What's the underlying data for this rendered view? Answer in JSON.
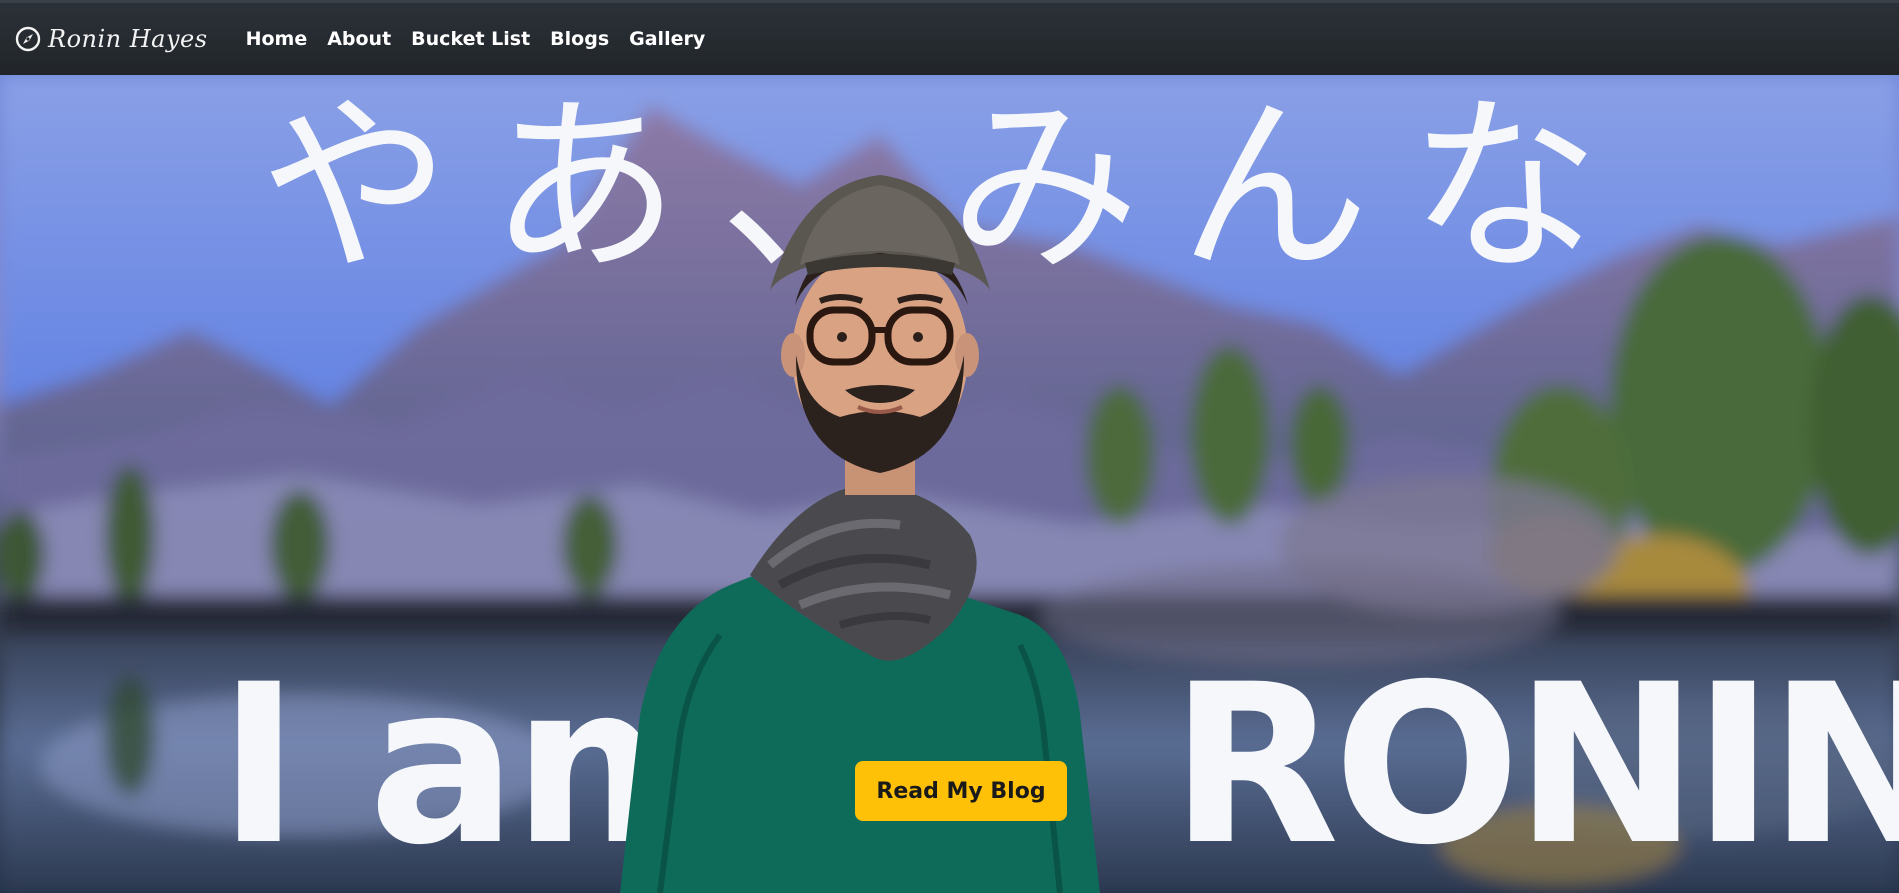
{
  "navbar": {
    "brand_name": "Ronin Hayes",
    "brand_icon": "compass-icon",
    "links": [
      "Home",
      "About",
      "Bucket List",
      "Blogs",
      "Gallery"
    ]
  },
  "hero": {
    "greeting": "やあ、みんな",
    "intro_left": "I am",
    "intro_right": "RONIN",
    "cta_label": "Read My Blog"
  },
  "colors": {
    "navbar_bg": "#212529",
    "cta_bg": "#ffc107",
    "hero_text": "#f5f7fb"
  }
}
